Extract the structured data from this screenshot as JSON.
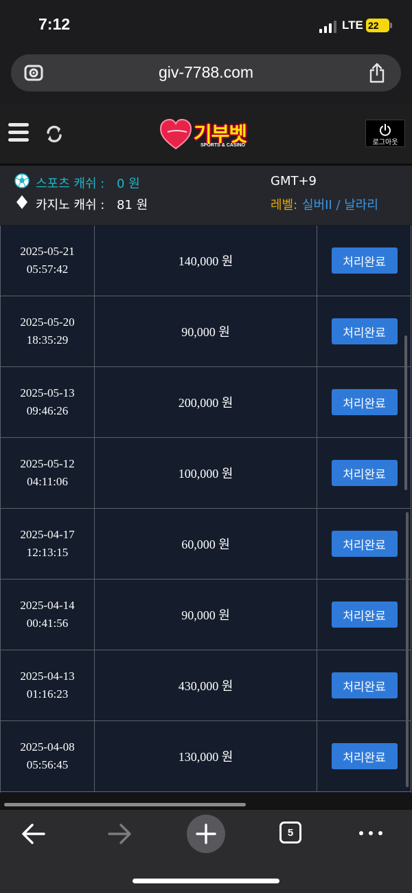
{
  "status_bar": {
    "time": "7:12",
    "network": "LTE",
    "battery": "22"
  },
  "browser": {
    "url": "giv-7788.com",
    "open_tabs": "5"
  },
  "header": {
    "logo_text": "기부벳",
    "logo_subtitle": "SPORTS & CASINO",
    "logout_label": "로그아웃"
  },
  "account": {
    "sports_cash_label": "스포츠 캐쉬 :",
    "sports_cash_value": "0 원",
    "casino_cash_label": "카지노 캐쉬 :",
    "casino_cash_value": "81 원",
    "timezone": "GMT+9",
    "level_label": "레벨:",
    "level_value": "실버II / 날라리"
  },
  "rows": [
    {
      "date": "2025-05-21",
      "time": "05:57:42",
      "amount": "140,000 원",
      "status": "처리완료"
    },
    {
      "date": "2025-05-20",
      "time": "18:35:29",
      "amount": "90,000 원",
      "status": "처리완료"
    },
    {
      "date": "2025-05-13",
      "time": "09:46:26",
      "amount": "200,000 원",
      "status": "처리완료"
    },
    {
      "date": "2025-05-12",
      "time": "04:11:06",
      "amount": "100,000 원",
      "status": "처리완료"
    },
    {
      "date": "2025-04-17",
      "time": "12:13:15",
      "amount": "60,000 원",
      "status": "처리완료"
    },
    {
      "date": "2025-04-14",
      "time": "00:41:56",
      "amount": "90,000 원",
      "status": "처리완료"
    },
    {
      "date": "2025-04-13",
      "time": "01:16:23",
      "amount": "430,000 원",
      "status": "처리완료"
    },
    {
      "date": "2025-04-08",
      "time": "05:56:45",
      "amount": "130,000 원",
      "status": "처리완료"
    }
  ],
  "colors": {
    "page_background": "#1c1c1e",
    "table_background": "#151d2c",
    "status_button": "#2f7ad9",
    "sports_cash_text": "#1fb6c8",
    "level_label_text": "#e6a800",
    "level_value_text": "#3a98e6",
    "logo_yellow": "#ffe600",
    "logo_heart": "#e8234a"
  },
  "icons": {
    "address_bar_left": "lens-icon",
    "address_bar_right": "share-icon",
    "header_left": [
      "menu-icon",
      "refresh-icon"
    ],
    "header_right": "power-icon",
    "sports": "soccer-ball-icon",
    "casino": "diamond-icon",
    "toolbar": [
      "back-arrow-icon",
      "forward-arrow-icon",
      "plus-icon",
      "tabs-icon",
      "more-icon"
    ]
  }
}
